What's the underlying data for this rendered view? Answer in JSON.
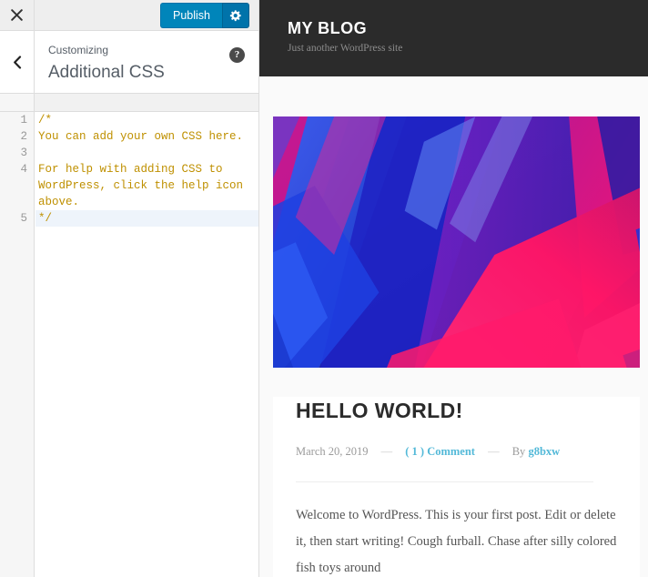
{
  "customizer": {
    "close_label": "Close",
    "back_label": "Back",
    "publish_label": "Publish",
    "gear_label": "Publish settings",
    "help_label": "?",
    "eyebrow": "Customizing",
    "title": "Additional CSS",
    "editor": {
      "lines": [
        {
          "num": "1",
          "text": "/*",
          "active": false
        },
        {
          "num": "2",
          "text": "You can add your own CSS here.",
          "active": false
        },
        {
          "num": "3",
          "text": "",
          "active": false
        },
        {
          "num": "4",
          "text": "For help with adding CSS to WordPress, click the help icon above.",
          "active": false
        },
        {
          "num": "5",
          "text": "*/",
          "active": true
        }
      ]
    }
  },
  "preview": {
    "site_title": "MY BLOG",
    "site_tagline": "Just another WordPress site",
    "post": {
      "title": "HELLO WORLD!",
      "date": "March 20, 2019",
      "separator": "—",
      "comments": "( 1 ) Comment",
      "by_label": "By",
      "author": "g8bxw",
      "body": "Welcome to WordPress. This is your first post. Edit or delete it, then start writing! Cough furball. Chase after silly colored fish toys around"
    }
  },
  "colors": {
    "accent": "#0085ba",
    "link": "#53b9d8",
    "header_bg": "#2b2b2b",
    "code_text": "#bf9000"
  }
}
